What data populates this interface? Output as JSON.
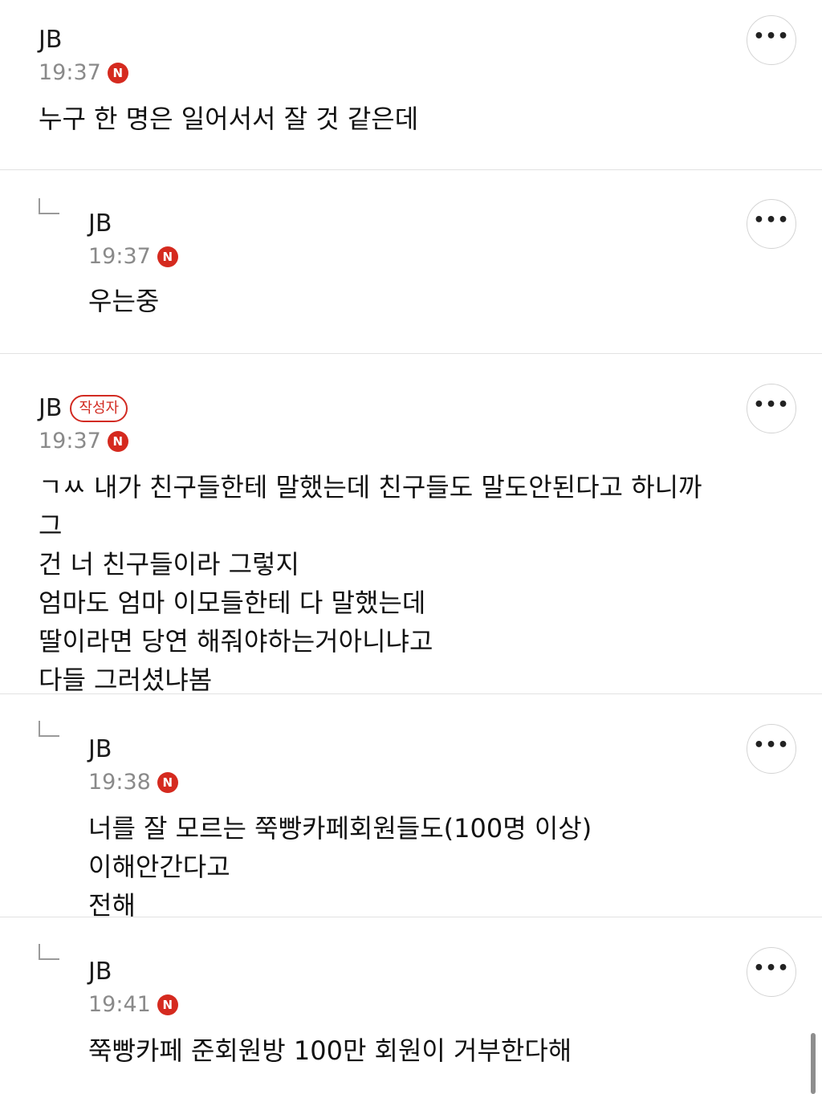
{
  "comments": [
    {
      "author": "JB",
      "time": "19:37",
      "new_badge": "N",
      "text": "누구 한 명은 일어서서 잘 것 같은데",
      "more": "•••"
    },
    {
      "author": "JB",
      "time": "19:37",
      "new_badge": "N",
      "text": "우는중",
      "more": "•••"
    },
    {
      "author": "JB",
      "writer_badge": "작성자",
      "time": "19:37",
      "new_badge": "N",
      "text": "ㄱㅆ 내가 친구들한테 말했는데 친구들도 말도안된다고 하니까 그\n건 너 친구들이라 그렇지\n엄마도 엄마 이모들한테 다 말했는데\n딸이라면 당연 해줘야하는거아니냐고\n다들 그러셨냐봄",
      "more": "•••"
    },
    {
      "author": "JB",
      "time": "19:38",
      "new_badge": "N",
      "text": "너를 잘 모르는 쭉빵카페회원들도(100명 이상) 이해안간다고\n전해",
      "more": "•••"
    },
    {
      "author": "JB",
      "time": "19:41",
      "new_badge": "N",
      "text": "쭉빵카페 준회원방 100만 회원이 거부한다해",
      "more": "•••"
    }
  ],
  "colors": {
    "accent": "#d52a1f",
    "divider": "#e2e2e2",
    "time": "#8a8a8a"
  },
  "icons": {
    "more": "more-options-icon",
    "reply": "reply-arrow-icon",
    "new": "new-badge-icon"
  }
}
